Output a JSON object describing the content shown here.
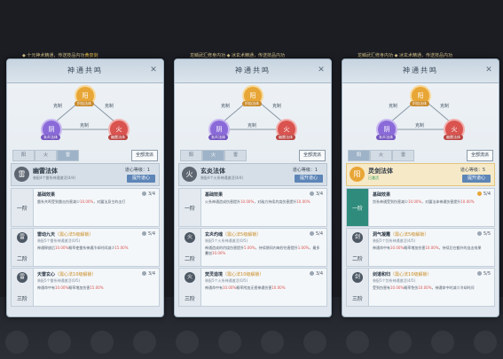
{
  "panels": [
    {
      "topbar": "◆ 十元神术精通，传送技品内功",
      "topbar_highlight": "黄泉剑",
      "title": "神通共鸣",
      "diagram": {
        "top": "阳",
        "top_label": "炽焰法体",
        "left": "阴",
        "left_label": "玄炎法体",
        "right": "火",
        "right_label": "幽雷法体",
        "edge_top_left": "克制",
        "edge_top_right": "克制",
        "edge_bottom": "克制"
      },
      "tabs": [
        "阳",
        "火",
        "雷"
      ],
      "active_tab": 2,
      "show_all": "全部流派",
      "type": {
        "icon": "雷",
        "name": "幽雷法体",
        "sub": "装配4个雷系神通激活(4/4)",
        "level_label": "道心等级：1",
        "upgrade": "提升道心",
        "gold": false
      },
      "tiers": [
        {
          "label": "一阶",
          "lit": false,
          "icon": "",
          "name": "基础效果",
          "cond": "",
          "req": "",
          "prog": "3/4",
          "desc": [
            "雷系共鸣受到雷击伤害减少",
            "10.00%",
            "，对震法身主的击打"
          ]
        },
        {
          "label": "二阶",
          "lit": false,
          "icon": "雷",
          "name": "雷动九天",
          "cond": "（需心法5级解锁）",
          "req": "装配5个雷系神通激活(0/5)",
          "prog": "5/4",
          "desc": [
            "神通释放后",
            "10.00%",
            "概率使雷系神通冷却时间减少",
            "15.00%"
          ]
        },
        {
          "label": "三阶",
          "lit": false,
          "icon": "雷",
          "name": "天雷玄心",
          "cond": "（需心法10级解锁）",
          "req": "装配5个雷系神通激活(0/5)",
          "prog": "3/4",
          "desc": [
            "神通命中有",
            "10.00%",
            "概率增加伤害",
            "15.00%"
          ]
        }
      ]
    },
    {
      "topbar": "龙鳞武汇修身内功 ◆ 冰玄术精通，传送技品内功",
      "topbar_highlight": "",
      "title": "神通共鸣",
      "diagram": {
        "top": "阳",
        "top_label": "炽焰法体",
        "left": "阴",
        "left_label": "玄炎法体",
        "right": "火",
        "right_label": "幽雷法体",
        "edge_top_left": "克制",
        "edge_top_right": "克制",
        "edge_bottom": "克制"
      },
      "tabs": [
        "阳",
        "火",
        "雷"
      ],
      "active_tab": 1,
      "show_all": "全部流派",
      "type": {
        "icon": "火",
        "name": "玄炎法体",
        "sub": "装配4个火系神通激活(4/4)",
        "level_label": "道心等级：1",
        "upgrade": "提升道心",
        "gold": false
      },
      "tiers": [
        {
          "label": "一阶",
          "lit": false,
          "icon": "",
          "name": "基础效果",
          "cond": "",
          "req": "",
          "prog": "3/4",
          "desc": [
            "火系神通造成伤害提升",
            "10.00%",
            "，对敌方持续灼烧伤害提升",
            "10.00%"
          ]
        },
        {
          "label": "二阶",
          "lit": false,
          "icon": "火",
          "name": "玄炎灼魂",
          "cond": "（需心法5级解锁）",
          "req": "装配5个火系神通激活(0/5)",
          "prog": "5/4",
          "desc": [
            "神通造成的灼烧伤害提升",
            "5.00%",
            "，持续期间内每秒伤害提升",
            "1.00%",
            "，最多叠加",
            "10.00%"
          ]
        },
        {
          "label": "三阶",
          "lit": false,
          "icon": "火",
          "name": "焚灵造境",
          "cond": "（需心法10级解锁）",
          "req": "装配5个火系神通激活(0/5)",
          "prog": "3/4",
          "desc": [
            "神通命中有",
            "10.00%",
            "概率附加无视神通伤害",
            "10.00%"
          ]
        }
      ]
    },
    {
      "topbar": "龙鳞武汇修身内功 ◆ 冰玄术精通，传送技品内功",
      "topbar_highlight": "",
      "title": "神通共鸣",
      "diagram": {
        "top": "阳",
        "top_label": "炽焰法体",
        "left": "阴",
        "left_label": "玄炎法体",
        "right": "火",
        "right_label": "幽雷法体",
        "edge_top_left": "克制",
        "edge_top_right": "克制",
        "edge_bottom": "克制"
      },
      "tabs": [
        "阳",
        "火",
        "雷"
      ],
      "active_tab": 0,
      "show_all": "全部流派",
      "type": {
        "icon": "阳",
        "name": "灵剑法体",
        "sub": "已激活",
        "level_label": "道心等级：5",
        "upgrade": "提升道心",
        "gold": true
      },
      "tiers": [
        {
          "label": "一阶",
          "lit": true,
          "icon": "",
          "name": "基础效果",
          "cond": "",
          "req": "",
          "prog": "5/4",
          "desc": [
            "剑系神通受到伤害减少",
            "10.00%",
            "，对震法体神通伤害提升",
            "10.00%"
          ]
        },
        {
          "label": "二阶",
          "lit": false,
          "icon": "剑",
          "name": "洞气凝霞",
          "cond": "（需心法5级解锁）",
          "req": "装配5个剑系神通激活(4/5)",
          "prog": "5/5",
          "desc": [
            "神通命中有",
            "10.00%",
            "概率增加伤害",
            "10.00%",
            "，持续后在额外的连击效果"
          ]
        },
        {
          "label": "三阶",
          "lit": false,
          "icon": "剑",
          "name": "剑道和归",
          "cond": "（需心法10级解锁）",
          "req": "装配5个剑系神通激活(4/5)",
          "prog": "5/5",
          "desc": [
            "受到伤害有",
            "10.00%",
            "概率免伤",
            "10.00%",
            "，神通命中时减少冷却时间"
          ]
        }
      ]
    }
  ]
}
